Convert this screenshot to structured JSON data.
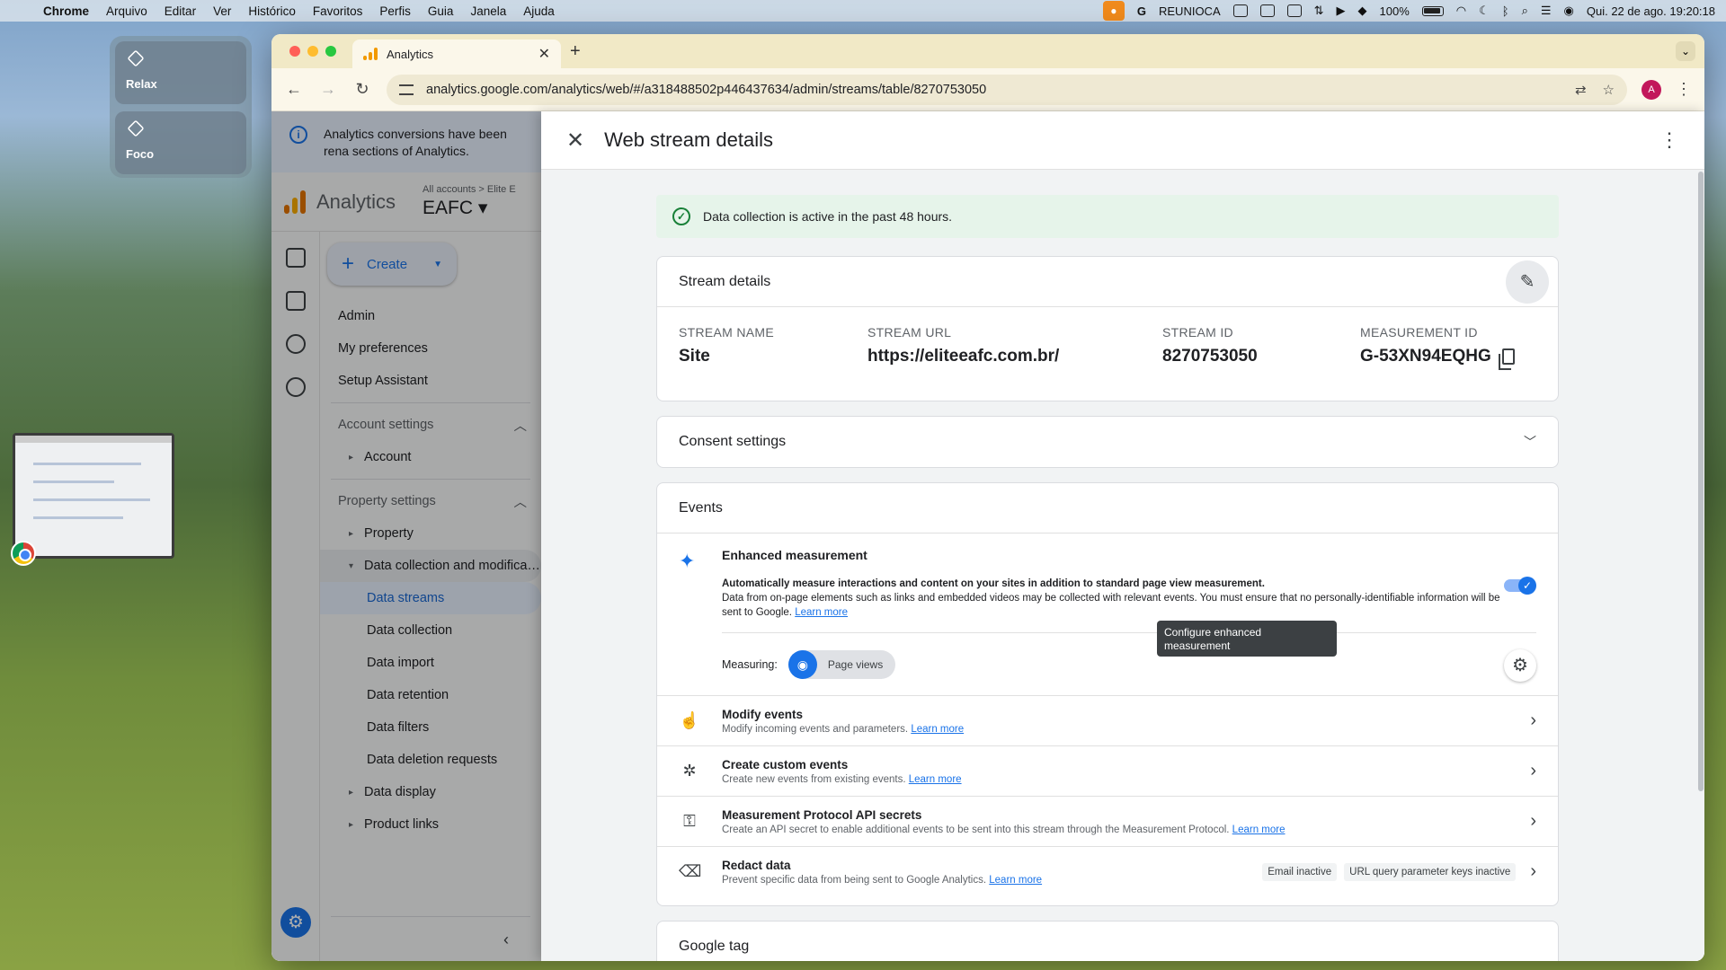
{
  "menubar": {
    "app": "Chrome",
    "items": [
      "Arquivo",
      "Editar",
      "Ver",
      "Histórico",
      "Favoritos",
      "Perfis",
      "Guia",
      "Janela",
      "Ajuda"
    ],
    "right_label": "REUNIOCA",
    "battery": "100%",
    "datetime": "Qui. 22 de ago.  19:20:18"
  },
  "focus": {
    "relax": "Relax",
    "foco": "Foco"
  },
  "browser": {
    "tab_title": "Analytics",
    "url": "analytics.google.com/analytics/web/#/a318488502p446437634/admin/streams/table/8270753050",
    "avatar_letter": "A"
  },
  "ga": {
    "banner_text": "Analytics conversions have been rena sections of Analytics.",
    "app_name": "Analytics",
    "breadcrumb": "All accounts > Elite E",
    "property": "EAFC",
    "create_label": "Create",
    "nav": {
      "admin": "Admin",
      "preferences": "My preferences",
      "setup": "Setup Assistant",
      "account_settings": "Account settings",
      "account": "Account",
      "property_settings": "Property settings",
      "property": "Property",
      "data_collection_mod": "Data collection and modifica…",
      "data_streams": "Data streams",
      "data_collection": "Data collection",
      "data_import": "Data import",
      "data_retention": "Data retention",
      "data_filters": "Data filters",
      "data_deletion": "Data deletion requests",
      "data_display": "Data display",
      "product_links": "Product links"
    }
  },
  "panel": {
    "title": "Web stream details",
    "alert": "Data collection is active in the past 48 hours.",
    "stream_details": {
      "heading": "Stream details",
      "name_label": "STREAM NAME",
      "name": "Site",
      "url_label": "STREAM URL",
      "url": "https://eliteeafc.com.br/",
      "id_label": "STREAM ID",
      "id": "8270753050",
      "mid_label": "MEASUREMENT ID",
      "mid": "G-53XN94EQHG"
    },
    "consent": "Consent settings",
    "events": {
      "heading": "Events",
      "em_title": "Enhanced measurement",
      "em_desc_bold": "Automatically measure interactions and content on your sites in addition to standard page view measurement.",
      "em_desc": "Data from on-page elements such as links and embedded videos may be collected with relevant events. You must ensure that no personally-identifiable information will be sent to Google.",
      "learn_more": "Learn more",
      "measuring_label": "Measuring:",
      "chip": "Page views",
      "tooltip": "Configure enhanced measurement",
      "rows": [
        {
          "title": "Modify events",
          "sub": "Modify incoming events and parameters."
        },
        {
          "title": "Create custom events",
          "sub": "Create new events from existing events."
        },
        {
          "title": "Measurement Protocol API secrets",
          "sub": "Create an API secret to enable additional events to be sent into this stream through the Measurement Protocol."
        },
        {
          "title": "Redact data",
          "sub": "Prevent specific data from being sent to Google Analytics."
        }
      ],
      "redact_tags": [
        "Email inactive",
        "URL query parameter keys inactive"
      ]
    },
    "google_tag": "Google tag"
  }
}
